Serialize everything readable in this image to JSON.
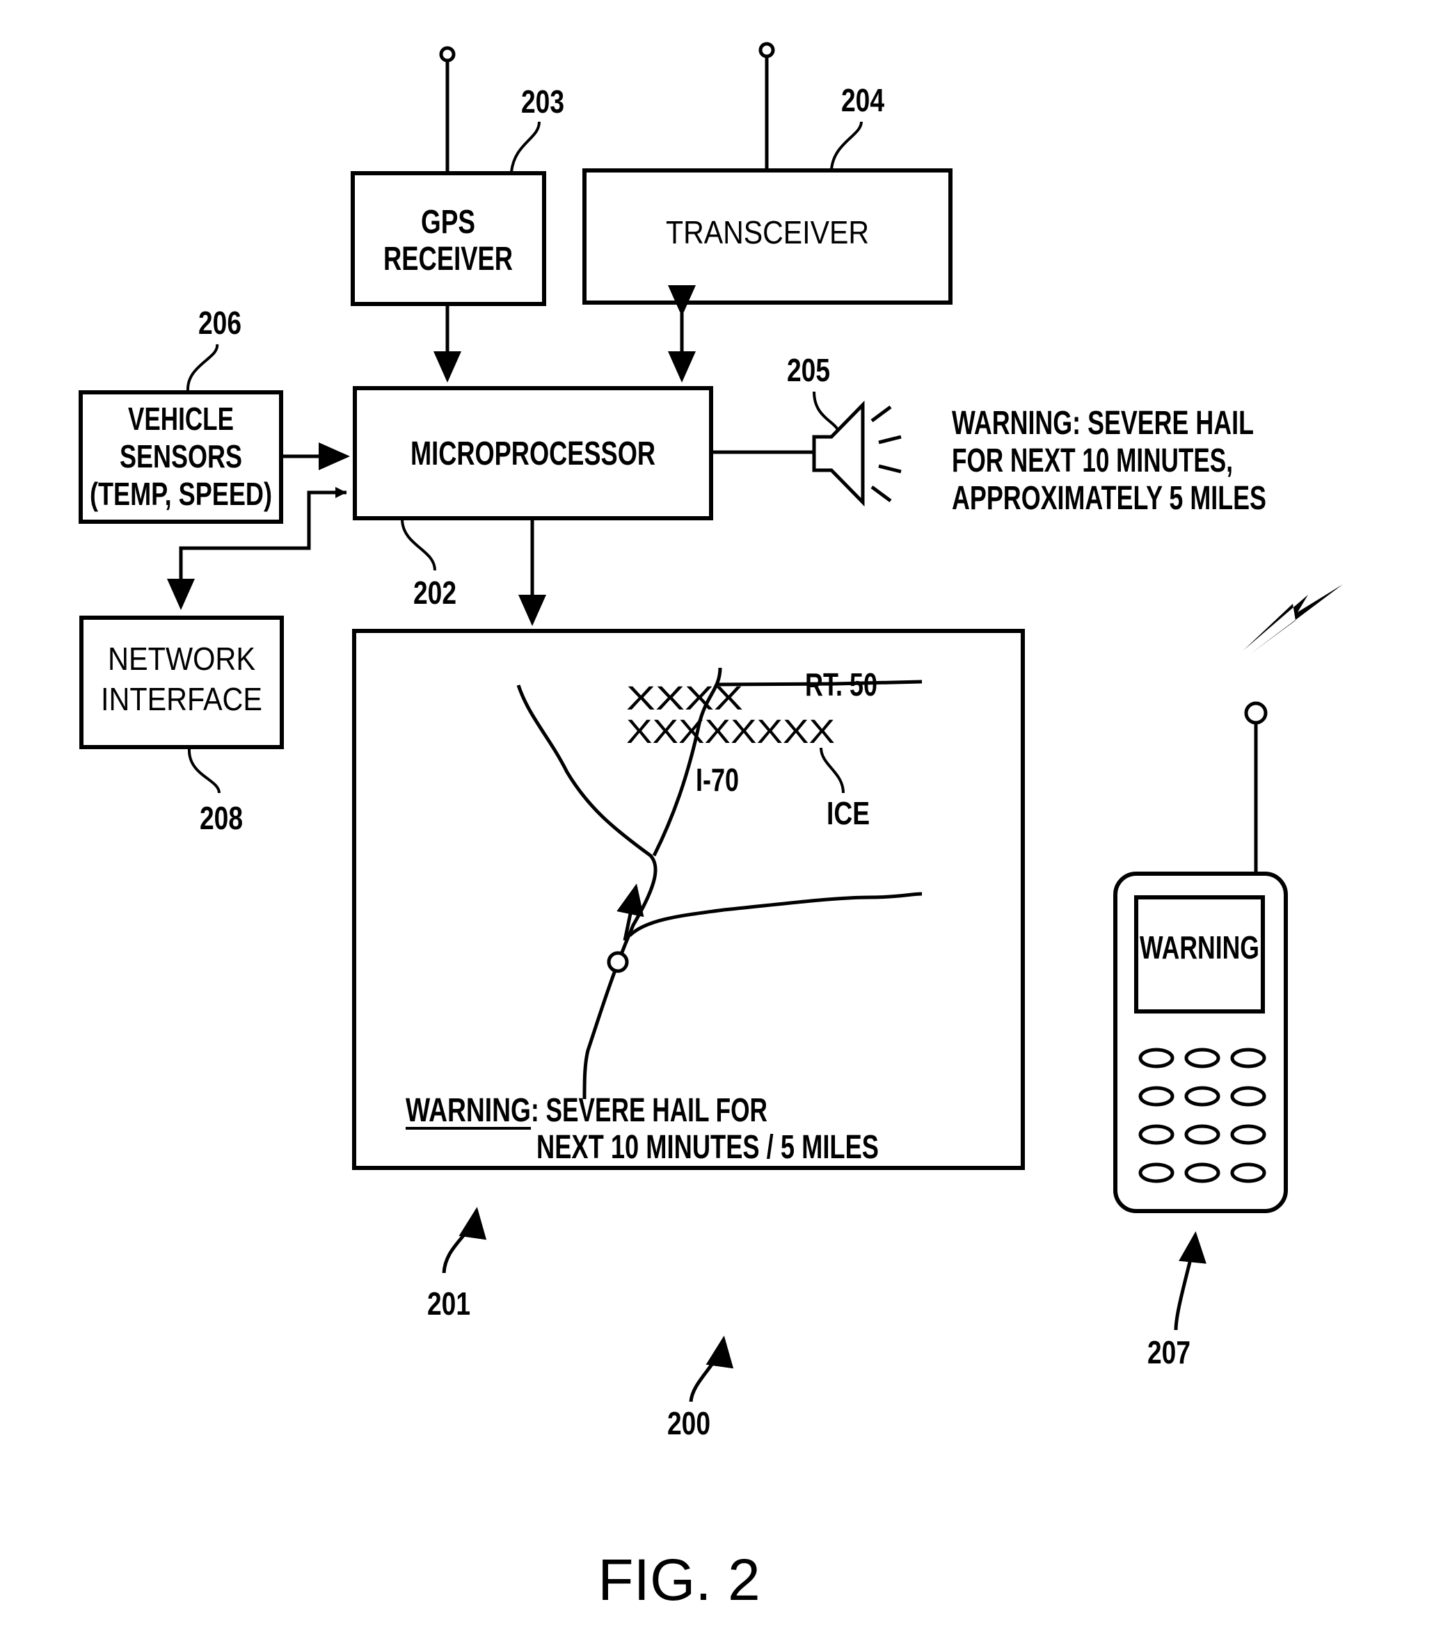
{
  "figure": {
    "caption": "FIG. 2",
    "system_ref": "200"
  },
  "components": {
    "gps": {
      "ref": "203",
      "line1": "GPS",
      "line2": "RECEIVER"
    },
    "transceiver": {
      "ref": "204",
      "label": "TRANSCEIVER"
    },
    "microprocessor": {
      "ref": "202",
      "label": "MICROPROCESSOR"
    },
    "vehicle_sensors": {
      "ref": "206",
      "line1": "VEHICLE",
      "line2": "SENSORS",
      "line3": "(TEMP, SPEED)"
    },
    "network_interface": {
      "ref": "208",
      "line1": "NETWORK",
      "line2": "INTERFACE"
    },
    "speaker": {
      "ref": "205",
      "message_lines": [
        "WARNING: SEVERE HAIL",
        "FOR NEXT 10 MINUTES,",
        "APPROXIMATELY 5 MILES"
      ]
    },
    "display": {
      "ref": "201",
      "map_labels": {
        "route_a": "RT. 50",
        "route_b": "I-70",
        "hazard": "ICE"
      },
      "ice_marks_row1": "XXXX",
      "ice_marks_row2": "XXXXXXXX",
      "warning_label": "WARNING",
      "warning_rest": ": SEVERE HAIL FOR",
      "warning_line2": "NEXT 10 MINUTES / 5 MILES"
    },
    "phone": {
      "ref": "207",
      "screen_text": "WARNING",
      "keypad_rows": 4,
      "keypad_cols": 3
    }
  }
}
